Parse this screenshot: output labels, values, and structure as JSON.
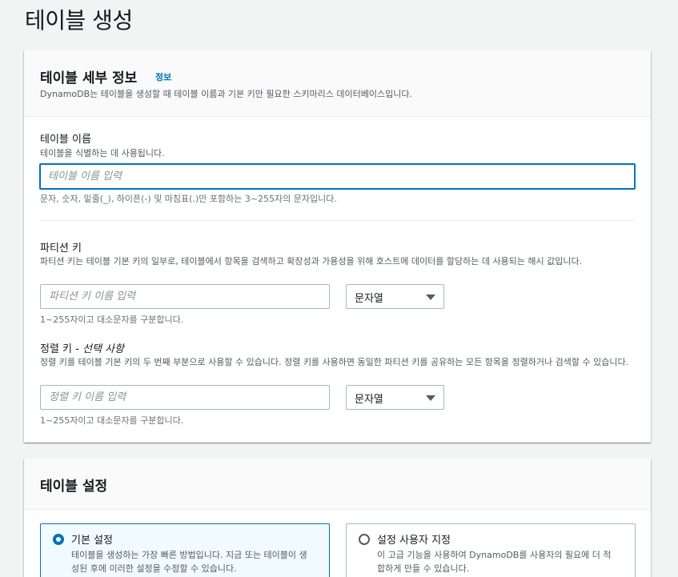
{
  "page": {
    "title": "테이블 생성"
  },
  "details": {
    "heading": "테이블 세부 정보",
    "info_link": "정보",
    "description": "DynamoDB는 테이블을 생성할 때 테이블 이름과 기본 키만 필요한 스키마리스 데이터베이스입니다.",
    "table_name": {
      "label": "테이블 이름",
      "description": "테이블을 식별하는 데 사용됩니다.",
      "placeholder": "테이블 이름 입력",
      "value": "",
      "constraint": "문자, 숫자, 밑줄(_), 하이픈(-) 및 마침표(.)만 포함하는 3~255자의 문자입니다."
    },
    "partition_key": {
      "label": "파티션 키",
      "description": "파티션 키는 테이블 기본 키의 일부로, 테이블에서 항목을 검색하고 확장성과 가용성을 위해 호스트에 데이터를 할당하는 데 사용되는 해시 값입니다.",
      "placeholder": "파티션 키 이름 입력",
      "value": "",
      "type_selected": "문자열",
      "constraint": "1~255자이고 대소문자를 구분합니다."
    },
    "sort_key": {
      "label": "정렬 키",
      "optional_label": "- 선택 사항",
      "description": "정렬 키를 테이블 기본 키의 두 번째 부분으로 사용할 수 있습니다. 정렬 키를 사용하면 동일한 파티션 키를 공유하는 모든 항목을 정렬하거나 검색할 수 있습니다.",
      "placeholder": "정렬 키 이름 입력",
      "value": "",
      "type_selected": "문자열",
      "constraint": "1~255자이고 대소문자를 구분합니다."
    }
  },
  "settings": {
    "heading": "테이블 설정",
    "options": [
      {
        "label": "기본 설정",
        "description": "테이블을 생성하는 가장 빠른 방법입니다. 지금 또는 테이블이 생성된 후에 이러한 설정을 수정할 수 있습니다.",
        "selected": true
      },
      {
        "label": "설정 사용자 지정",
        "description": "이 고급 기능을 사용하여 DynamoDB를 사용자의 필요에 더 적합하게 만들 수 있습니다.",
        "selected": false
      }
    ]
  },
  "colors": {
    "accent": "#0073bb",
    "background": "#f2f3f3",
    "panel_header": "#fafafa"
  },
  "icons": {
    "select_caret": "caret-down-icon",
    "radio": "radio-button-icon"
  }
}
